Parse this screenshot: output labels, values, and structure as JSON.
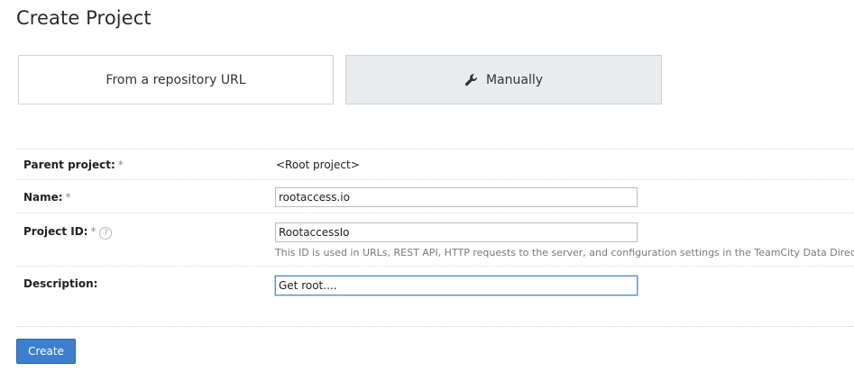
{
  "page": {
    "title": "Create Project"
  },
  "tabs": {
    "repository_label": "From a repository URL",
    "manual_label": "Manually",
    "manual_icon": "wrench-icon",
    "active": "Manually"
  },
  "form": {
    "parent_project": {
      "label": "Parent project:",
      "required_mark": "*",
      "value": "<Root project>"
    },
    "name": {
      "label": "Name:",
      "required_mark": "*",
      "value": "rootaccess.io"
    },
    "project_id": {
      "label": "Project ID:",
      "required_mark": "*",
      "help_icon": "question-circle-icon",
      "help_glyph": "?",
      "value": "RootaccessIo",
      "hint": "This ID is used in URLs, REST API, HTTP requests to the server, and configuration settings in the TeamCity Data Directory."
    },
    "description": {
      "label": "Description:",
      "value": "Get root...."
    }
  },
  "actions": {
    "create_label": "Create"
  },
  "colors": {
    "primary_button": "#3d7fcf",
    "active_tab_bg": "#e9ecee",
    "focus_border": "#5b8fd0"
  }
}
